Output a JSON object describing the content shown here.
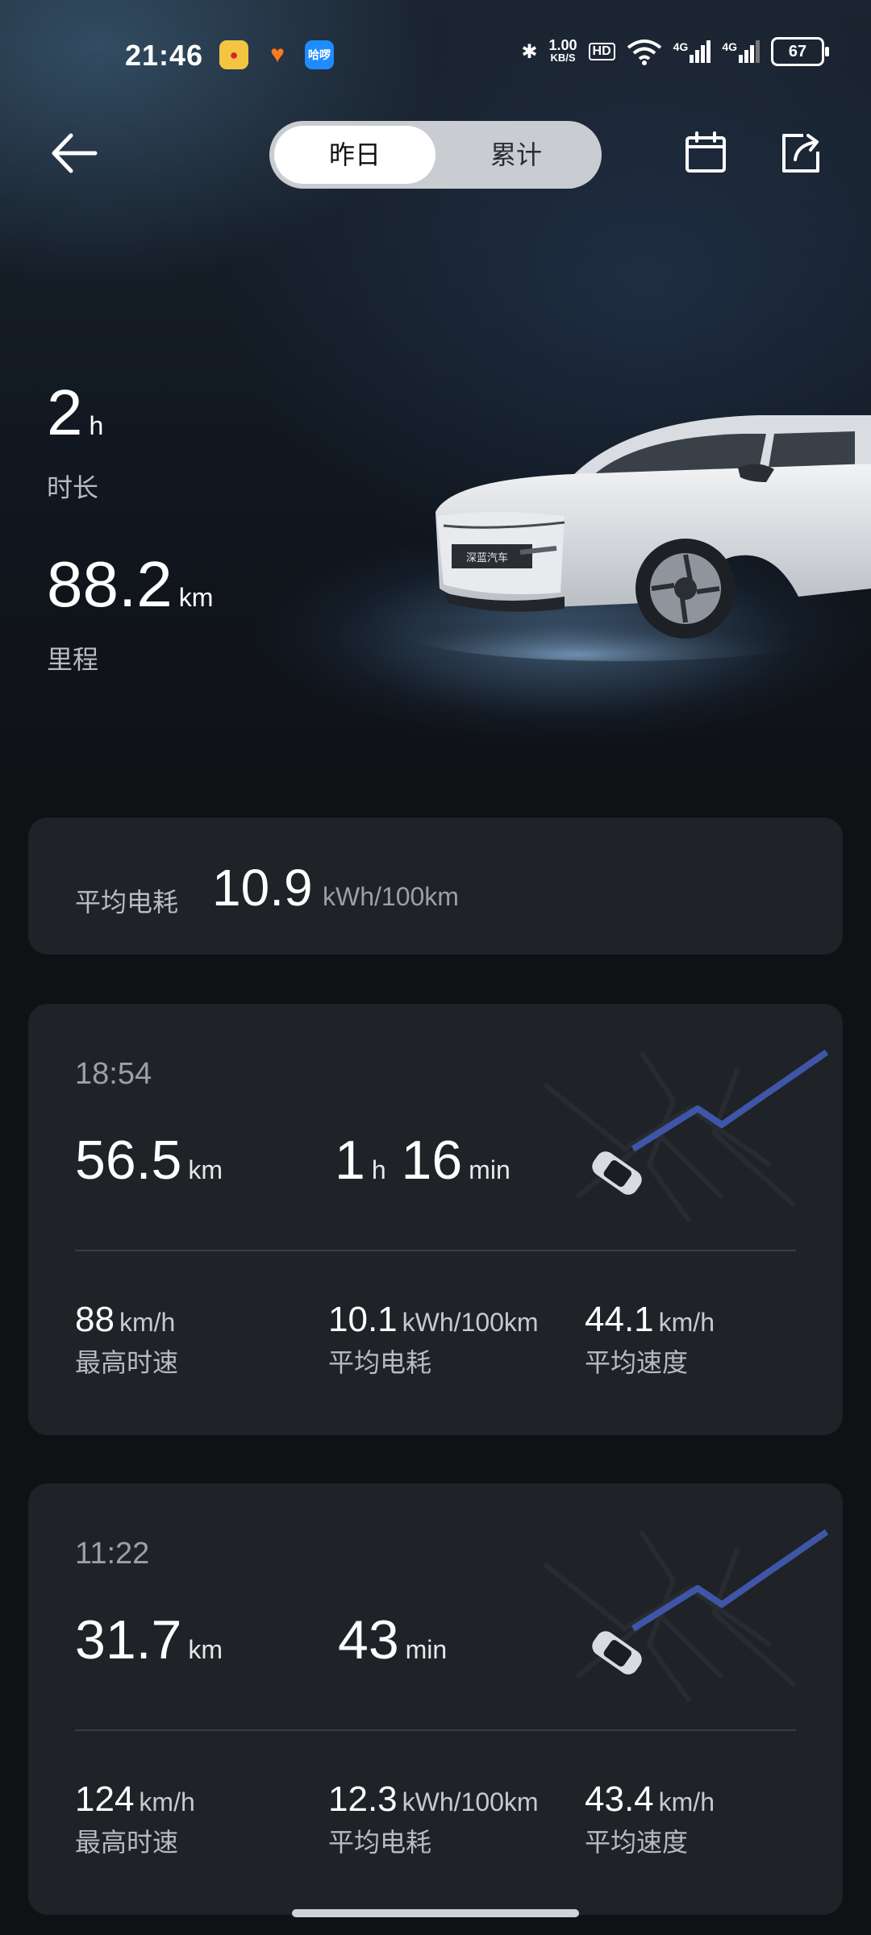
{
  "status_bar": {
    "time": "21:46",
    "net_speed_value": "1.00",
    "net_speed_unit": "KB/S",
    "hd_badge": "HD",
    "sim1": "4G",
    "sim2": "4G",
    "battery": "67",
    "app_icons": [
      "weibo-icon",
      "taobao-icon",
      "haluo-icon"
    ],
    "haluo_text": "哈啰"
  },
  "nav": {
    "tabs": [
      {
        "label": "昨日",
        "active": true
      },
      {
        "label": "累计",
        "active": false
      }
    ],
    "icons": [
      "back-arrow-icon",
      "calendar-icon",
      "share-icon"
    ]
  },
  "hero": {
    "duration_value": "2",
    "duration_unit": "h",
    "duration_label": "时长",
    "distance_value": "88.2",
    "distance_unit": "km",
    "distance_label": "里程",
    "car_plate": "深蓝汽车"
  },
  "avg_consumption": {
    "label": "平均电耗",
    "value": "10.9",
    "unit": "kWh/100km"
  },
  "trips": [
    {
      "time": "18:54",
      "distance": "56.5",
      "distance_unit": "km",
      "duration_h": "1",
      "duration_h_unit": "h",
      "duration_min": "16",
      "duration_min_unit": "min",
      "max_speed": "88",
      "max_speed_unit": "km/h",
      "max_speed_label": "最高时速",
      "consumption": "10.1",
      "consumption_unit": "kWh/100km",
      "consumption_label": "平均电耗",
      "avg_speed": "44.1",
      "avg_speed_unit": "km/h",
      "avg_speed_label": "平均速度"
    },
    {
      "time": "11:22",
      "distance": "31.7",
      "distance_unit": "km",
      "duration_min": "43",
      "duration_min_unit": "min",
      "max_speed": "124",
      "max_speed_unit": "km/h",
      "max_speed_label": "最高时速",
      "consumption": "12.3",
      "consumption_unit": "kWh/100km",
      "consumption_label": "平均电耗",
      "avg_speed": "43.4",
      "avg_speed_unit": "km/h",
      "avg_speed_label": "平均速度"
    }
  ],
  "colors": {
    "background": "#0f1114",
    "card": "#1f2226",
    "route_line": "#3f56a8",
    "segment_bg": "#c9ccd1"
  }
}
